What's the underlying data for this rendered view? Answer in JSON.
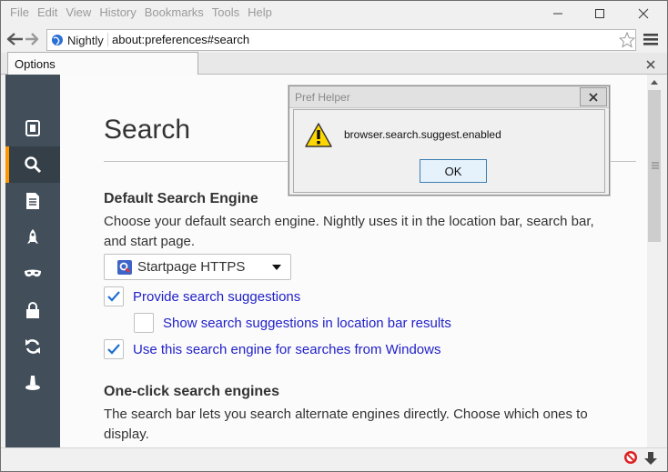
{
  "menu": [
    "File",
    "Edit",
    "View",
    "History",
    "Bookmarks",
    "Tools",
    "Help"
  ],
  "identity": {
    "label": "Nightly"
  },
  "urlbar": {
    "url": "about:preferences#search"
  },
  "tab": {
    "label": "Options"
  },
  "sidebar": {
    "items": [
      {
        "icon": "general-icon"
      },
      {
        "icon": "search-icon",
        "selected": true
      },
      {
        "icon": "content-icon"
      },
      {
        "icon": "applications-icon"
      },
      {
        "icon": "privacy-mask-icon"
      },
      {
        "icon": "security-lock-icon"
      },
      {
        "icon": "sync-icon"
      },
      {
        "icon": "advanced-wizard-icon"
      }
    ]
  },
  "main": {
    "title": "Search",
    "default_engine": {
      "heading": "Default Search Engine",
      "description": "Choose your default search engine. Nightly uses it in the location bar, search bar, and start page.",
      "selected_engine": "Startpage HTTPS"
    },
    "checkboxes": [
      {
        "label": "Provide search suggestions",
        "checked": true
      },
      {
        "label": "Show search suggestions in location bar results",
        "checked": false
      },
      {
        "label": "Use this search engine for searches from Windows",
        "checked": true
      }
    ],
    "one_click": {
      "heading": "One-click search engines",
      "description": "The search bar lets you search alternate engines directly. Choose which ones to display."
    }
  },
  "dialog": {
    "title": "Pref Helper",
    "message": "browser.search.suggest.enabled",
    "ok_label": "OK"
  },
  "colors": {
    "sidebar_bg": "#424f5a",
    "sidebar_accent": "#ff9500",
    "link_blue": "#2121c9"
  }
}
